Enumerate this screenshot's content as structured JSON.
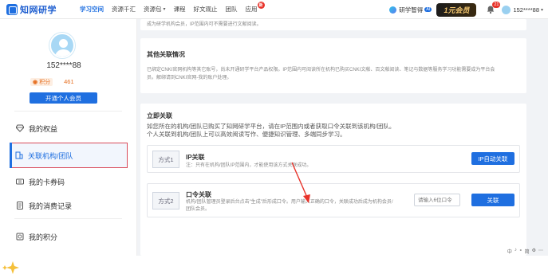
{
  "colors": {
    "brand": "#1f6fe0",
    "highlight_border": "#d94a5a",
    "points": "#e66f20",
    "badge": "#e8332a"
  },
  "header": {
    "logo_text": "知网研学",
    "nav": [
      {
        "label": "学习空间",
        "active": true
      },
      {
        "label": "资源千汇"
      },
      {
        "label": "资源包",
        "caret": "▾"
      },
      {
        "label": "课程"
      },
      {
        "label": "好文观止"
      },
      {
        "label": "团队"
      },
      {
        "label": "应用",
        "badge": "新"
      }
    ],
    "ai_label": "研学智得",
    "ai_badge": "AI",
    "vip_banner": "1元会员",
    "notifications": "21",
    "username": "152****88",
    "user_caret": "▾"
  },
  "sidebar": {
    "profile_name": "152****88",
    "points_label": "积分",
    "points_value": "461",
    "open_vip_button": "开通个人会员",
    "menu": [
      {
        "label": "我的权益",
        "icon": "diamond-icon"
      },
      {
        "label": "关联机构/团队",
        "icon": "link-building-icon",
        "active": true
      },
      {
        "label": "我的卡券码",
        "icon": "ticket-icon"
      },
      {
        "label": "我的消费记录",
        "icon": "receipt-icon"
      },
      {
        "label": "我的积分",
        "icon": "coins-icon"
      }
    ]
  },
  "main": {
    "top_card_text": "成为研学机构会员，IP范围内可不需要进行文献阅读。",
    "other": {
      "title": "其他关联情况",
      "text1": "已绑定CNKI官网机构等其它账号，尚未开通研学平台产品权限。IP范围内可阅读所在机构已购买CNKI文献、百文献阅读、笔记与数据等服务学习功能需要成为平台会",
      "text2": "员。解绑请到CNKI官网-我的账户处理。"
    },
    "join": {
      "title": "立即关联",
      "line1": "如您所在的机构/团队已购买了知网研学平台，请在IP范围内或者获取口令关联到该机构/团队。",
      "line2": "个人关联到机构/团队上可以高效阅读写作、便捷知识管理、多端同步学习。",
      "methods": [
        {
          "tag": "方式1",
          "title": "IP关联",
          "desc": "注：只有在机构/团队IP范围内，才能使用该方式关联成功。",
          "button": "IP自动关联"
        },
        {
          "tag": "方式2",
          "title": "口令关联",
          "desc1": "机构/团队管理员登录后台点击\"生成\"后形成口令。用户输入正确的口令，关联成功后成为机构会员/",
          "desc2": "团队会员。",
          "placeholder": "请输入6位口令",
          "button": "关联"
        }
      ]
    }
  },
  "footer_tools": [
    "中",
    "♪",
    "∘",
    "简",
    "⚙",
    "⋯"
  ]
}
